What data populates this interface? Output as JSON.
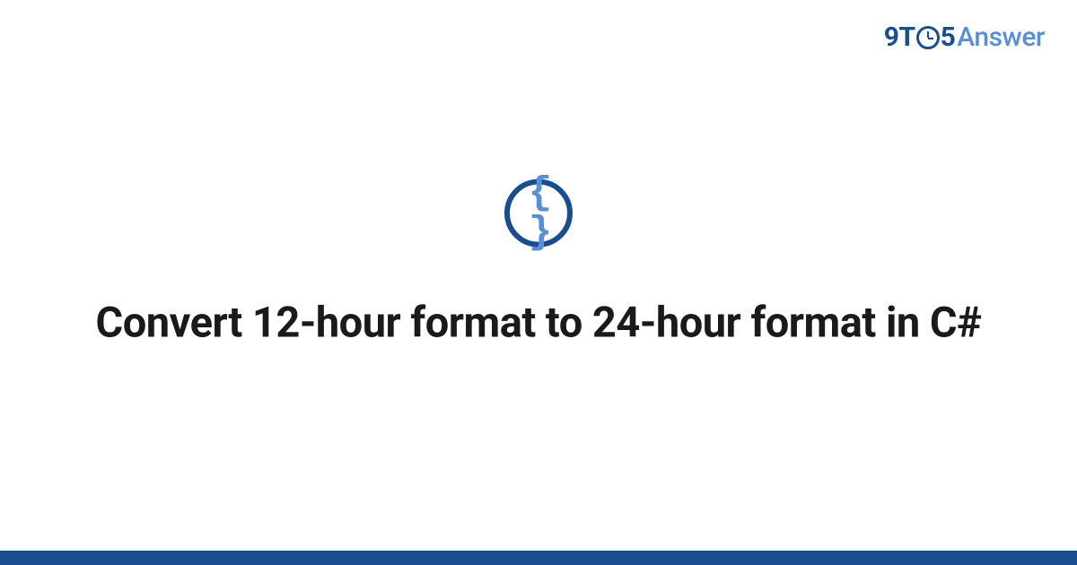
{
  "logo": {
    "part1": "9T",
    "part2": "5",
    "part3": "Answer"
  },
  "icon": {
    "glyph": "{ }",
    "name": "code-braces-icon"
  },
  "title": "Convert 12-hour format to 24-hour format in C#",
  "colors": {
    "brand_dark": "#1a4d8f",
    "brand_light": "#5a8fd4"
  }
}
